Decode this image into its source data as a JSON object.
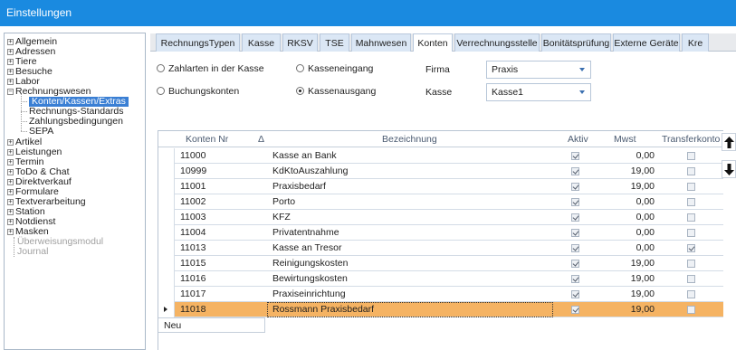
{
  "window": {
    "title": "Einstellungen"
  },
  "tree": {
    "items": [
      {
        "label": "Allgemein",
        "type": "plus"
      },
      {
        "label": "Adressen",
        "type": "plus"
      },
      {
        "label": "Tiere",
        "type": "plus"
      },
      {
        "label": "Besuche",
        "type": "plus"
      },
      {
        "label": "Labor",
        "type": "plus"
      },
      {
        "label": "Rechnungswesen",
        "type": "minus"
      },
      {
        "label": "Konten/Kassen/Extras",
        "type": "child-selected"
      },
      {
        "label": "Rechnungs-Standards",
        "type": "child"
      },
      {
        "label": "Zahlungsbedingungen",
        "type": "child"
      },
      {
        "label": "SEPA",
        "type": "child"
      },
      {
        "label": "Artikel",
        "type": "plus"
      },
      {
        "label": "Leistungen",
        "type": "plus"
      },
      {
        "label": "Termin",
        "type": "plus"
      },
      {
        "label": "ToDo & Chat",
        "type": "plus"
      },
      {
        "label": "Direktverkauf",
        "type": "plus"
      },
      {
        "label": "Formulare",
        "type": "plus"
      },
      {
        "label": "Textverarbeitung",
        "type": "plus"
      },
      {
        "label": "Station",
        "type": "plus"
      },
      {
        "label": "Notdienst",
        "type": "plus"
      },
      {
        "label": "Masken",
        "type": "plus"
      },
      {
        "label": "Überweisungsmodul",
        "type": "disabled"
      },
      {
        "label": "Journal",
        "type": "disabled"
      }
    ]
  },
  "tabs": [
    {
      "label": "RechnungsTypen",
      "active": false
    },
    {
      "label": "Kasse",
      "active": false
    },
    {
      "label": "RKSV",
      "active": false
    },
    {
      "label": "TSE",
      "active": false
    },
    {
      "label": "Mahnwesen",
      "active": false
    },
    {
      "label": "Konten",
      "active": true
    },
    {
      "label": "Verrechnungsstelle",
      "active": false
    },
    {
      "label": "Bonitätsprüfung",
      "active": false
    },
    {
      "label": "Externe Geräte",
      "active": false
    },
    {
      "label": "Kre",
      "active": false
    }
  ],
  "filters": {
    "radio_zahlarten": "Zahlarten in der Kasse",
    "radio_buchungskonten": "Buchungskonten",
    "radio_kasseneingang": "Kasseneingang",
    "radio_kassenausgang": "Kassenausgang",
    "firma_label": "Firma",
    "firma_value": "Praxis",
    "kasse_label": "Kasse",
    "kasse_value": "Kasse1"
  },
  "grid": {
    "columns": {
      "konten_nr": "Konten Nr",
      "sort_marker": "Δ",
      "bezeichnung": "Bezeichnung",
      "aktiv": "Aktiv",
      "mwst": "Mwst",
      "transferkonto": "Transferkonto"
    },
    "rows": [
      {
        "nr": "11000",
        "bez": "Kasse an Bank",
        "aktiv": true,
        "mwst": "0,00",
        "transfer": false,
        "selected": false
      },
      {
        "nr": "10999",
        "bez": "KdKtoAuszahlung",
        "aktiv": true,
        "mwst": "19,00",
        "transfer": false,
        "selected": false
      },
      {
        "nr": "11001",
        "bez": "Praxisbedarf",
        "aktiv": true,
        "mwst": "19,00",
        "transfer": false,
        "selected": false
      },
      {
        "nr": "11002",
        "bez": "Porto",
        "aktiv": true,
        "mwst": "0,00",
        "transfer": false,
        "selected": false
      },
      {
        "nr": "11003",
        "bez": "KFZ",
        "aktiv": true,
        "mwst": "0,00",
        "transfer": false,
        "selected": false
      },
      {
        "nr": "11004",
        "bez": "Privatentnahme",
        "aktiv": true,
        "mwst": "0,00",
        "transfer": false,
        "selected": false
      },
      {
        "nr": "11013",
        "bez": "Kasse an Tresor",
        "aktiv": true,
        "mwst": "0,00",
        "transfer": true,
        "selected": false
      },
      {
        "nr": "11015",
        "bez": "Reinigungskosten",
        "aktiv": true,
        "mwst": "19,00",
        "transfer": false,
        "selected": false
      },
      {
        "nr": "11016",
        "bez": "Bewirtungskosten",
        "aktiv": true,
        "mwst": "19,00",
        "transfer": false,
        "selected": false
      },
      {
        "nr": "11017",
        "bez": "Praxiseinrichtung",
        "aktiv": true,
        "mwst": "19,00",
        "transfer": false,
        "selected": false
      },
      {
        "nr": "11018",
        "bez": "Rossmann Praxisbedarf",
        "aktiv": true,
        "mwst": "19,00",
        "transfer": false,
        "selected": true
      }
    ],
    "new_row_label": "Neu"
  },
  "side_buttons": {
    "move_up": "arrow-up-icon",
    "move_down": "arrow-down-icon"
  }
}
